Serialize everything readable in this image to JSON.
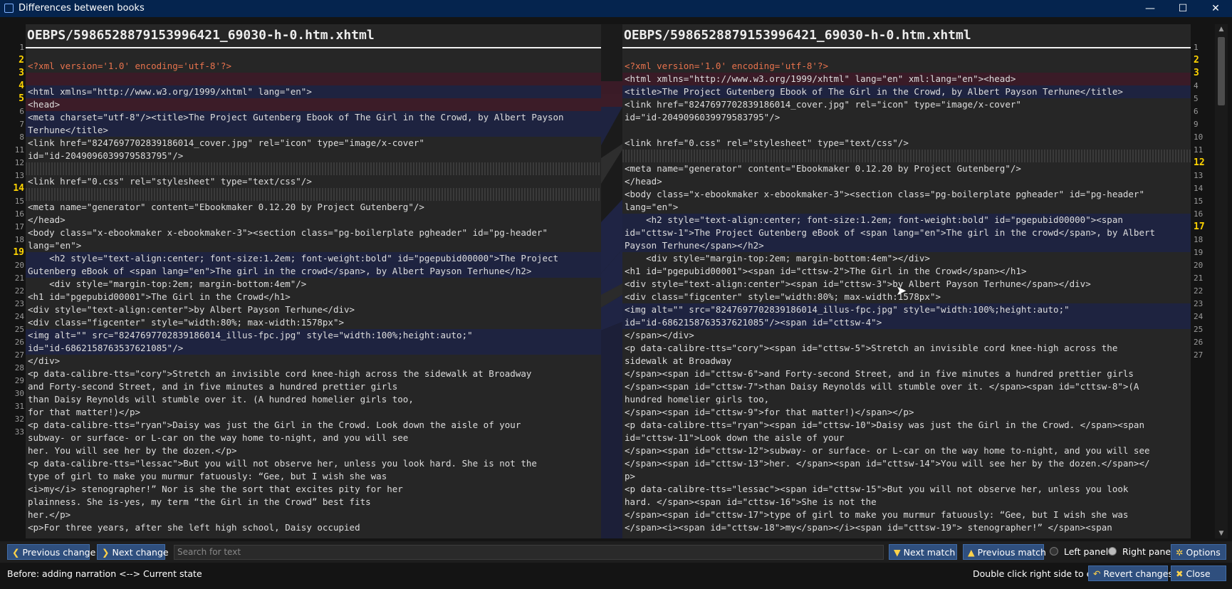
{
  "window": {
    "title": "Differences between books",
    "minimize_glyph": "—",
    "maximize_glyph": "☐",
    "close_glyph": "✕"
  },
  "left_panel": {
    "header": "OEBPS/5986528879153996421_69030-h-0.htm.xhtml",
    "line_numbers": [
      "1",
      "2",
      "3",
      "4",
      "5",
      "6",
      "7",
      "8",
      "11",
      "12",
      "13",
      "14",
      "15",
      "16",
      "17",
      "18",
      "19",
      "20",
      "21",
      "22",
      "23",
      "24",
      "25",
      "26",
      "27",
      "28",
      "29",
      "30",
      "31",
      "32",
      "33"
    ],
    "changed_line_numbers": [
      "2",
      "3",
      "4",
      "5",
      "14",
      "19"
    ]
  },
  "right_panel": {
    "header": "OEBPS/5986528879153996421_69030-h-0.htm.xhtml",
    "line_numbers": [
      "1",
      "2",
      "3",
      "4",
      "5",
      "6",
      "9",
      "10",
      "11",
      "12",
      "13",
      "14",
      "15",
      "16",
      "17",
      "18",
      "19",
      "20",
      "21",
      "22",
      "23",
      "24",
      "25",
      "26",
      "27"
    ],
    "changed_line_numbers": [
      "2",
      "3",
      "12",
      "17"
    ]
  },
  "left_lines": [
    "<?xml version='1.0' encoding='utf-8'?>",
    "",
    "<html xmlns=\"http://www.w3.org/1999/xhtml\" lang=\"en\">",
    "<head>",
    "<meta charset=\"utf-8\"/><title>The Project Gutenberg Ebook of The Girl in the Crowd, by Albert Payson",
    "Terhune</title>",
    "<link href=\"8247697702839186014_cover.jpg\" rel=\"icon\" type=\"image/x-cover\"",
    "id=\"id-2049096039979583795\"/>",
    "",
    "<link href=\"0.css\" rel=\"stylesheet\" type=\"text/css\"/>",
    "",
    "<meta name=\"generator\" content=\"Ebookmaker 0.12.20 by Project Gutenberg\"/>",
    "</head>",
    "<body class=\"x-ebookmaker x-ebookmaker-3\"><section class=\"pg-boilerplate pgheader\" id=\"pg-header\"",
    "lang=\"en\">",
    "    <h2 style=\"text-align:center; font-size:1.2em; font-weight:bold\" id=\"pgepubid00000\">The Project",
    "Gutenberg eBook of <span lang=\"en\">The girl in the crowd</span>, by Albert Payson Terhune</h2>",
    "    <div style=\"margin-top:2em; margin-bottom:4em\"/>",
    "<h1 id=\"pgepubid00001\">The Girl in the Crowd</h1>",
    "<div style=\"text-align:center\">by Albert Payson Terhune</div>",
    "<div class=\"figcenter\" style=\"width:80%; max-width:1578px\">",
    "<img alt=\"\" src=\"8247697702839186014_illus-fpc.jpg\" style=\"width:100%;height:auto;\"",
    "id=\"id-6862158763537621085\"/>",
    "</div>",
    "<p data-calibre-tts=\"cory\">Stretch an invisible cord knee-high across the sidewalk at Broadway",
    "and Forty-second Street, and in five minutes a hundred prettier girls",
    "than Daisy Reynolds will stumble over it. (A hundred homelier girls too,",
    "for that matter!)</p>",
    "<p data-calibre-tts=\"ryan\">Daisy was just the Girl in the Crowd. Look down the aisle of your",
    "subway- or surface- or L-car on the way home to-night, and you will see",
    "her. You will see her by the dozen.</p>",
    "<p data-calibre-tts=\"lessac\">But you will not observe her, unless you look hard. She is not the",
    "type of girl to make you murmur fatuously: “Gee, but I wish she was",
    "<i>my</i> stenographer!” Nor is she the sort that excites pity for her",
    "plainness. She is-yes, my term “the Girl in the Crowd” best fits",
    "her.</p>",
    "<p>For three years, after she left high school, Daisy occupied"
  ],
  "right_lines": [
    "<?xml version='1.0' encoding='utf-8'?>",
    "<html xmlns=\"http://www.w3.org/1999/xhtml\" lang=\"en\" xml:lang=\"en\"><head>",
    "<title>The Project Gutenberg Ebook of The Girl in the Crowd, by Albert Payson Terhune</title>",
    "<link href=\"8247697702839186014_cover.jpg\" rel=\"icon\" type=\"image/x-cover\"",
    "id=\"id-2049096039979583795\"/>",
    "",
    "<link href=\"0.css\" rel=\"stylesheet\" type=\"text/css\"/>",
    "",
    "<meta name=\"generator\" content=\"Ebookmaker 0.12.20 by Project Gutenberg\"/>",
    "</head>",
    "<body class=\"x-ebookmaker x-ebookmaker-3\"><section class=\"pg-boilerplate pgheader\" id=\"pg-header\"",
    "lang=\"en\">",
    "    <h2 style=\"text-align:center; font-size:1.2em; font-weight:bold\" id=\"pgepubid00000\"><span",
    "id=\"cttsw-1\">The Project Gutenberg eBook of <span lang=\"en\">The girl in the crowd</span>, by Albert",
    "Payson Terhune</span></h2>",
    "    <div style=\"margin-top:2em; margin-bottom:4em\"></div>",
    "<h1 id=\"pgepubid00001\"><span id=\"cttsw-2\">The Girl in the Crowd</span></h1>",
    "<div style=\"text-align:center\"><span id=\"cttsw-3\">by Albert Payson Terhune</span></div>",
    "<div class=\"figcenter\" style=\"width:80%; max-width:1578px\">",
    "<img alt=\"\" src=\"8247697702839186014_illus-fpc.jpg\" style=\"width:100%;height:auto;\"",
    "id=\"id-6862158763537621085\"/><span id=\"cttsw-4\">",
    "</span></div>",
    "<p data-calibre-tts=\"cory\"><span id=\"cttsw-5\">Stretch an invisible cord knee-high across the",
    "sidewalk at Broadway",
    "</span><span id=\"cttsw-6\">and Forty-second Street, and in five minutes a hundred prettier girls",
    "</span><span id=\"cttsw-7\">than Daisy Reynolds will stumble over it. </span><span id=\"cttsw-8\">(A",
    "hundred homelier girls too,",
    "</span><span id=\"cttsw-9\">for that matter!)</span></p>",
    "<p data-calibre-tts=\"ryan\"><span id=\"cttsw-10\">Daisy was just the Girl in the Crowd. </span><span",
    "id=\"cttsw-11\">Look down the aisle of your",
    "</span><span id=\"cttsw-12\">subway- or surface- or L-car on the way home to-night, and you will see",
    "</span><span id=\"cttsw-13\">her. </span><span id=\"cttsw-14\">You will see her by the dozen.</span></",
    "p>",
    "<p data-calibre-tts=\"lessac\"><span id=\"cttsw-15\">But you will not observe her, unless you look",
    "hard. </span><span id=\"cttsw-16\">She is not the",
    "</span><span id=\"cttsw-17\">type of girl to make you murmur fatuously: “Gee, but I wish she was",
    "</span><i><span id=\"cttsw-18\">my</span></i><span id=\"cttsw-19\"> stenographer!” </span><span"
  ],
  "toolbar": {
    "prev_change": "Previous change",
    "next_change": "Next change",
    "search_placeholder": "Search for text",
    "next_match": "Next match",
    "prev_match": "Previous match",
    "left_panel": "Left panel",
    "right_panel": "Right panel",
    "options": "Options",
    "revert": "Revert changes",
    "close": "Close"
  },
  "status": {
    "left": "Before: adding narration <--> Current state",
    "hint": "Double click right side to edit"
  },
  "colors": {
    "titlebar": "#05244e",
    "button": "#2f4f7e",
    "changed_line_number": "#ffd400",
    "replaced_bg": "#1e2340",
    "removed_bg": "#3a1b27",
    "tag": "#90c8f0",
    "string": "#8fd46f"
  }
}
